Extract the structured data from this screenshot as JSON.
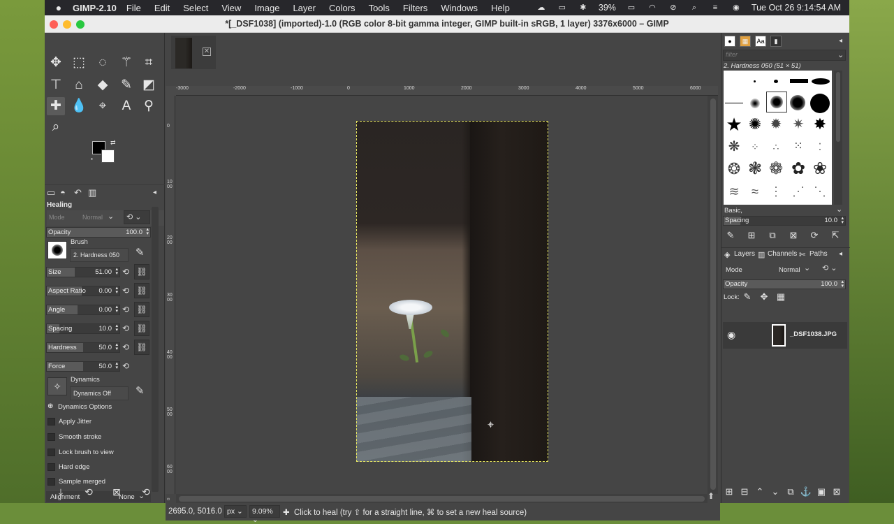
{
  "menubar": {
    "apple": "",
    "app": "GIMP-2.10",
    "menus": [
      "File",
      "Edit",
      "Select",
      "View",
      "Image",
      "Layer",
      "Colors",
      "Tools",
      "Filters",
      "Windows",
      "Help"
    ],
    "battery": "39%",
    "datetime": "Tue Oct 26  9:14:54 AM"
  },
  "window": {
    "title": "*[_DSF1038] (imported)-1.0 (RGB color 8-bit gamma integer, GIMP built-in sRGB, 1 layer) 3376x6000 – GIMP"
  },
  "tool_options": {
    "title": "Healing",
    "mode_label": "Mode",
    "mode_value": "Normal",
    "opacity": {
      "label": "Opacity",
      "value": "100.0"
    },
    "brush_label": "Brush",
    "brush_value": "2. Hardness 050",
    "sliders": [
      {
        "label": "Size",
        "value": "51.00"
      },
      {
        "label": "Aspect Ratio",
        "value": "0.00"
      },
      {
        "label": "Angle",
        "value": "0.00"
      },
      {
        "label": "Spacing",
        "value": "10.0"
      },
      {
        "label": "Hardness",
        "value": "50.0"
      },
      {
        "label": "Force",
        "value": "50.0"
      }
    ],
    "dynamics_label": "Dynamics",
    "dynamics_value": "Dynamics Off",
    "dynamics_options": "Dynamics Options",
    "checkboxes": [
      "Apply Jitter",
      "Smooth stroke",
      "Lock brush to view",
      "Hard edge",
      "Sample merged"
    ],
    "alignment_label": "Alignment",
    "alignment_value": "None"
  },
  "ruler": {
    "h_ticks": [
      "-3000",
      "-2000",
      "-1000",
      "0",
      "1000",
      "2000",
      "3000",
      "4000",
      "5000",
      "6000"
    ],
    "v_ticks": [
      "0",
      "1000",
      "2000",
      "3000",
      "4000",
      "5000",
      "6000"
    ]
  },
  "statusbar": {
    "coords": "2695.0, 5016.0",
    "unit": "px",
    "zoom": "9.09%",
    "message": "Click to heal (try ⇧ for a straight line, ⌘ to set a new heal source)"
  },
  "brushes": {
    "filter_placeholder": "filter",
    "current": "2. Hardness 050 (51 × 51)",
    "tag": "Basic,",
    "spacing": {
      "label": "Spacing",
      "value": "10.0"
    }
  },
  "layers": {
    "tabs": [
      "Layers",
      "Channels",
      "Paths"
    ],
    "mode_label": "Mode",
    "mode_value": "Normal",
    "opacity": {
      "label": "Opacity",
      "value": "100.0"
    },
    "lock_label": "Lock:",
    "layer_name": "_DSF1038.JPG"
  }
}
